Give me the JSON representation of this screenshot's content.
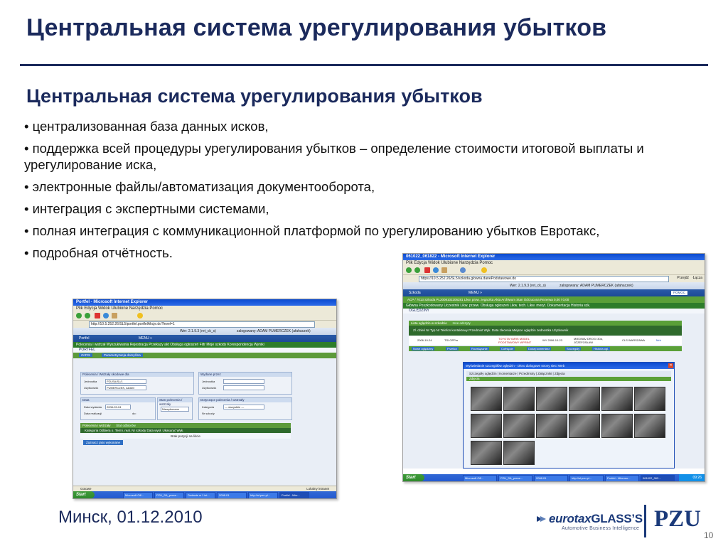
{
  "slide": {
    "title": "Центральная система урегулирования убытков",
    "subtitle": "Центральная система урегулирования убытков",
    "bullets": [
      "• централизованная база данных исков,",
      "• поддержка всей процедуры урегулирования убытков  – определение стоимости итоговой выплаты и урегулирование иска,",
      "• электронные файлы/автоматизация документооборота,",
      "• интеграция с экспертными системами,",
      "• полная интеграция с коммуникационной платформой  по урегулированию убытков Евротакс,",
      "• подробная отчётность."
    ],
    "footer_city_date": "Минск, 01.12.2010",
    "page_number": "10"
  },
  "logos": {
    "eurotax_part1": "eurotax",
    "eurotax_part2": "GLASS’S",
    "eurotax_tagline": "Automotive Business Intelligence",
    "pzu": "PZU"
  },
  "screenshot_left": {
    "window_title": "Portfel - Microsoft Internet Explorer",
    "menu": "Plik  Edycja  Widok  Ulubione  Narzędzia  Pomoc",
    "address": "http://10.5.252.26/SL5/portfel.portfelAkcje.do?level=1",
    "version_text": "Wer: 2.1.9.3 (ret_ck_s)",
    "login_text": "zalogowany: ADAM PUMERCZEK  (afahaczek)",
    "logout": "wyloguj",
    "module": "Portfel",
    "menu_btn": "MENU »",
    "tabs": "Polecenia i wstrzał  Wyszukiwania  Rejestracja  Przekazy akt  Obsługa ogłoszeń  Filtr  Moje szkody  Korespondencja  Wyniki",
    "section_portfel": "PORTFEL",
    "btn_sheet": "ZAPIS",
    "btn_params": "Parametryzacja domyślna",
    "panel1_title": "Polecenia / Wstzały skodowe dla",
    "panel1_unit_label": "Jednostka",
    "panel1_unit_value": "PZUSA/SL/1",
    "panel1_user_label": "Użytkownik",
    "panel1_user_value": "PUMERCZEK, ADAM",
    "panel2_title": "Wydane przez",
    "panel2_unit_label": "Jednostka",
    "panel2_user_label": "Użytkownik",
    "panel3_title": "Data",
    "panel3_from_label": "Data wysłania",
    "panel3_from_value": "2008-09-04",
    "panel3_to_label": "Data realizacji",
    "panel3_to_prefix": "do:",
    "panel4_title": "Stan polecenia / wstrzały",
    "panel4_value": "Niewykonane",
    "panel5_title": "Dotyczące polecenia / wstrzały",
    "panel5_cat_label": "Kategoria",
    "panel5_cat_value": "--- wszystkie ---",
    "panel5_nr_label": "Nr szkody",
    "result_header": "Polecenia i wstrzały",
    "result_sub": "Stat odbiorów",
    "grid_cols": "Kategoria   Odbiera o.   Termi. real.   Nr szkody   Data wysł.   Ukasuryć   Wyk.",
    "grid_empty": "Brak pozycji na liście",
    "btn_done": "Zaznacz jako wykonane",
    "status_done": "Gotowe",
    "status_zone": "Lokalny intranet",
    "taskbar_start": "Start",
    "taskbar_items": [
      "Microsoft Off...",
      "PZU_SA_prese...",
      "Dodanie w 1 ist...",
      "2008.01",
      "http://sl.pzu.pl...",
      "Portfel - Micr..."
    ]
  },
  "screenshot_right": {
    "window_title": "061022_061822 - Microsoft Internet Explorer",
    "menu": "Plik  Edycja  Widok  Ulubione  Narzędzia  Pomoc",
    "address": "https://10.5.252.26/SL5/szkoda.glowna.danePodstawowe.do",
    "address_btn": "Przejdź",
    "links_btn": "Łącza",
    "version_text": "Wer: 2.1.9.3 (ret_ck_s)",
    "login_text": "zalogowany: ADAM PUMERCZEK  (afahaczek)",
    "logout": "wyloguj",
    "help": "POMOC",
    "module": "Szkoda",
    "menu_btn": "MENU »",
    "claim_info": "ACP / 7013   Szkoda  PL2008102206281   Likw. prow. zegarzka   Akta  Archiwum   Stan  Odrzucona   Rezerwa  0,00 / 0,00",
    "tabs": "Główna  Poszkodowany  Uczestnik  Likw. przew.  Obsługa ogłoszeń  Likw. tech.  Likw. meryt.  Dokumentacja  Historia szk.",
    "section_label": "OGLĘDZINY",
    "list_title": "Lista oględzin w szkodzie",
    "list_sub": "Inne odczyty",
    "grid_cols": "Zl. dzień  Nr  Typ  Nr  Telefon kontaktowy  Przedmiot  Wyk. Data zlecenia  Miejsce oględzin  Jednostka  Użytkownik",
    "row_date": "2006-10-24",
    "row_type": "TSI  OPPer",
    "row_item": "TOYOTA YARIS MODEL PODSTAWOWY WPRINT",
    "row_done": "WY  2006-10-23",
    "row_place": "MIEDNIA/ DROGI 30a, JÓZEFOSŁAW",
    "row_unit": "CLS WARSZAWA",
    "row_user": "Mrb",
    "action_buttons": [
      "Nowe oględziny",
      "Przelicz",
      "Rozwiązanie",
      "Cofnięcie",
      "Dodaj komentarz",
      "Szczegóły",
      "Historia ogl."
    ],
    "modal_title": "Wyświetlanie szczegółów oględzin - Okno dialogowe strony sieci Web",
    "modal_tabs": "Szczegóły oględzin | Komentarze | Przedmioty | Załączniki | Zdjęcia",
    "modal_section": "Zdjęcia",
    "taskbar_start": "Start",
    "taskbar_items": [
      "Microsoft Off...",
      "PZU_SA_prese...",
      "2008.01",
      "http://sl.pzu.pl...",
      "Portfel - Microso...",
      "061022_062..."
    ],
    "clock": "09:26"
  }
}
